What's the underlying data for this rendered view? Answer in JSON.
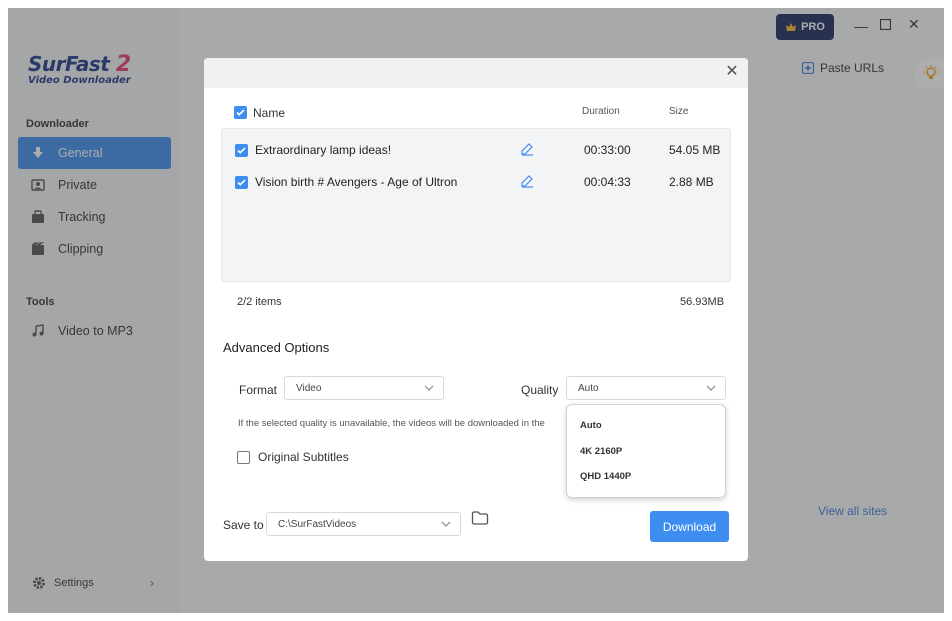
{
  "app": {
    "brand_name": "SurFast",
    "brand_number": "2",
    "brand_sub": "Video Downloader",
    "pro_label": "PRO",
    "paste_urls_label": "Paste URLs",
    "view_all_sites_label": "View all sites"
  },
  "sidebar": {
    "downloader_label": "Downloader",
    "tools_label": "Tools",
    "items": [
      {
        "label": "General",
        "icon": "download-arrow-icon",
        "active": true
      },
      {
        "label": "Private",
        "icon": "private-icon",
        "active": false
      },
      {
        "label": "Tracking",
        "icon": "tracking-icon",
        "active": false
      },
      {
        "label": "Clipping",
        "icon": "clipping-icon",
        "active": false
      }
    ],
    "tools": [
      {
        "label": "Video to MP3",
        "icon": "music-note-icon"
      }
    ],
    "settings_label": "Settings"
  },
  "dialog": {
    "columns": {
      "name": "Name",
      "duration": "Duration",
      "size": "Size"
    },
    "rows": [
      {
        "name": "Extraordinary lamp ideas!",
        "duration": "00:33:00",
        "size": "54.05 MB",
        "checked": true
      },
      {
        "name": "Vision birth # Avengers - Age of Ultron",
        "duration": "00:04:33",
        "size": "2.88 MB",
        "checked": true
      }
    ],
    "items_count": "2/2 items",
    "total_size": "56.93MB",
    "advanced_title": "Advanced Options",
    "format_label": "Format",
    "format_value": "Video",
    "quality_label": "Quality",
    "quality_value": "Auto",
    "quality_options": [
      "Auto",
      "4K 2160P",
      "QHD 1440P"
    ],
    "note": "If the selected quality is unavailable, the videos will be downloaded in the",
    "subtitles_label": "Original Subtitles",
    "subtitles_checked": false,
    "save_to_label": "Save to",
    "save_path": "C:\\SurFastVideos",
    "download_label": "Download"
  },
  "colors": {
    "accent": "#3d8ef0",
    "brand_dark": "#1b2a5e",
    "brand_pink": "#e23c6a"
  }
}
